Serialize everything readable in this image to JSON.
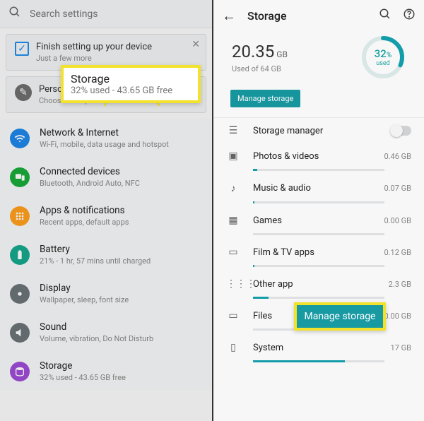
{
  "left": {
    "search_placeholder": "Search settings",
    "card1": {
      "title": "Finish setting up your device",
      "sub": "Just a few more"
    },
    "card2": {
      "title": "Personalise",
      "sub": "Choose fonts, colours and more"
    },
    "rows": [
      {
        "icon_bg": "#1f87e8",
        "glyph": "wifi",
        "title": "Network & Internet",
        "sub": "Wi-Fi, mobile, data usage and hotspot"
      },
      {
        "icon_bg": "#1aab3a",
        "glyph": "devices",
        "title": "Connected devices",
        "sub": "Bluetooth, Android Auto, NFC"
      },
      {
        "icon_bg": "#ff9f1e",
        "glyph": "apps",
        "title": "Apps & notifications",
        "sub": "Recent apps, default apps"
      },
      {
        "icon_bg": "#16a88c",
        "glyph": "battery",
        "title": "Battery",
        "sub": "21% - 1 hr, 57 mins until charged"
      },
      {
        "icon_bg": "#6b7478",
        "glyph": "display",
        "title": "Display",
        "sub": "Wallpaper, sleep, font size"
      },
      {
        "icon_bg": "#6b7478",
        "glyph": "volume",
        "title": "Sound",
        "sub": "Volume, vibration, Do Not Disturb"
      },
      {
        "icon_bg": "#9e4bd6",
        "glyph": "storage",
        "title": "Storage",
        "sub": "32% used - 43.65 GB free"
      }
    ]
  },
  "right": {
    "title": "Storage",
    "used_value": "20.35",
    "used_unit": "GB",
    "used_sub": "Used of 64 GB",
    "pct": "32",
    "pct_unit": "%",
    "pct_label": "used",
    "manage_btn": "Manage storage",
    "storage_mgr": "Storage manager",
    "cats": [
      {
        "label": "Photos & videos",
        "val": "0.46 GB",
        "pct": 3
      },
      {
        "label": "Music & audio",
        "val": "0.07 GB",
        "pct": 1
      },
      {
        "label": "Games",
        "val": "0.00 GB",
        "pct": 0
      },
      {
        "label": "Film & TV apps",
        "val": "0.12 GB",
        "pct": 1
      },
      {
        "label": "Other app",
        "val": "2.3 GB",
        "pct": 12
      },
      {
        "label": "Files",
        "val": "0.00 GB",
        "pct": 0
      },
      {
        "label": "System",
        "val": "17 GB",
        "pct": 70
      }
    ]
  },
  "callouts": {
    "storage_title": "Storage",
    "storage_sub": "32% used - 43.65 GB free",
    "manage": "Manage storage"
  }
}
